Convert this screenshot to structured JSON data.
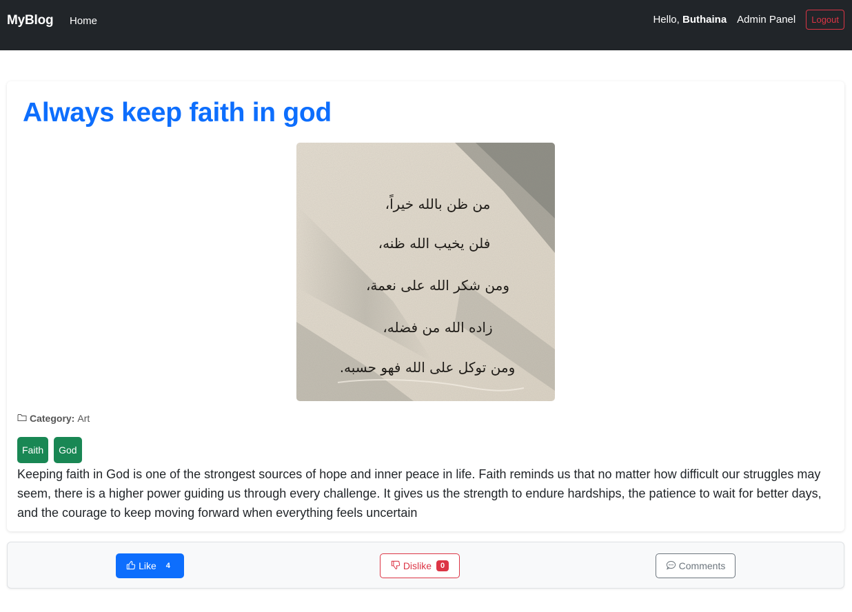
{
  "navbar": {
    "brand": "MyBlog",
    "home_label": "Home",
    "greeting": "Hello,",
    "username": "Buthaina",
    "admin_label": "Admin Panel",
    "logout_label": "Logout"
  },
  "post": {
    "title": "Always keep faith in god",
    "image_lines": [
      "من ظن بالله خيراً،",
      "فلن يخيب الله ظنه،",
      "ومن شكر الله على نعمة،",
      "زاده الله من فضله،",
      "ومن توكل على الله فهو حسبه."
    ],
    "category_label": "Category:",
    "category_value": "Art",
    "tags": [
      "Faith",
      "God"
    ],
    "content": "Keeping faith in God is one of the strongest sources of hope and inner peace in life. Faith reminds us that no matter how difficult our struggles may seem, there is a higher power guiding us through every challenge. It gives us the strength to endure hardships, the patience to wait for better days, and the courage to keep moving forward when everything feels uncertain"
  },
  "actions": {
    "like_label": "Like",
    "like_count": "4",
    "dislike_label": "Dislike",
    "dislike_count": "0",
    "comments_label": "Comments"
  },
  "icons": {
    "category": "folder-icon",
    "like": "thumbs-up-icon",
    "dislike": "thumbs-down-icon",
    "comments": "chat-icon"
  },
  "colors": {
    "navbar_bg": "#212529",
    "title": "#0d6efd",
    "tag_bg": "#198754",
    "like_bg": "#0d6efd",
    "dislike": "#dc3545",
    "comments": "#6c757d"
  }
}
